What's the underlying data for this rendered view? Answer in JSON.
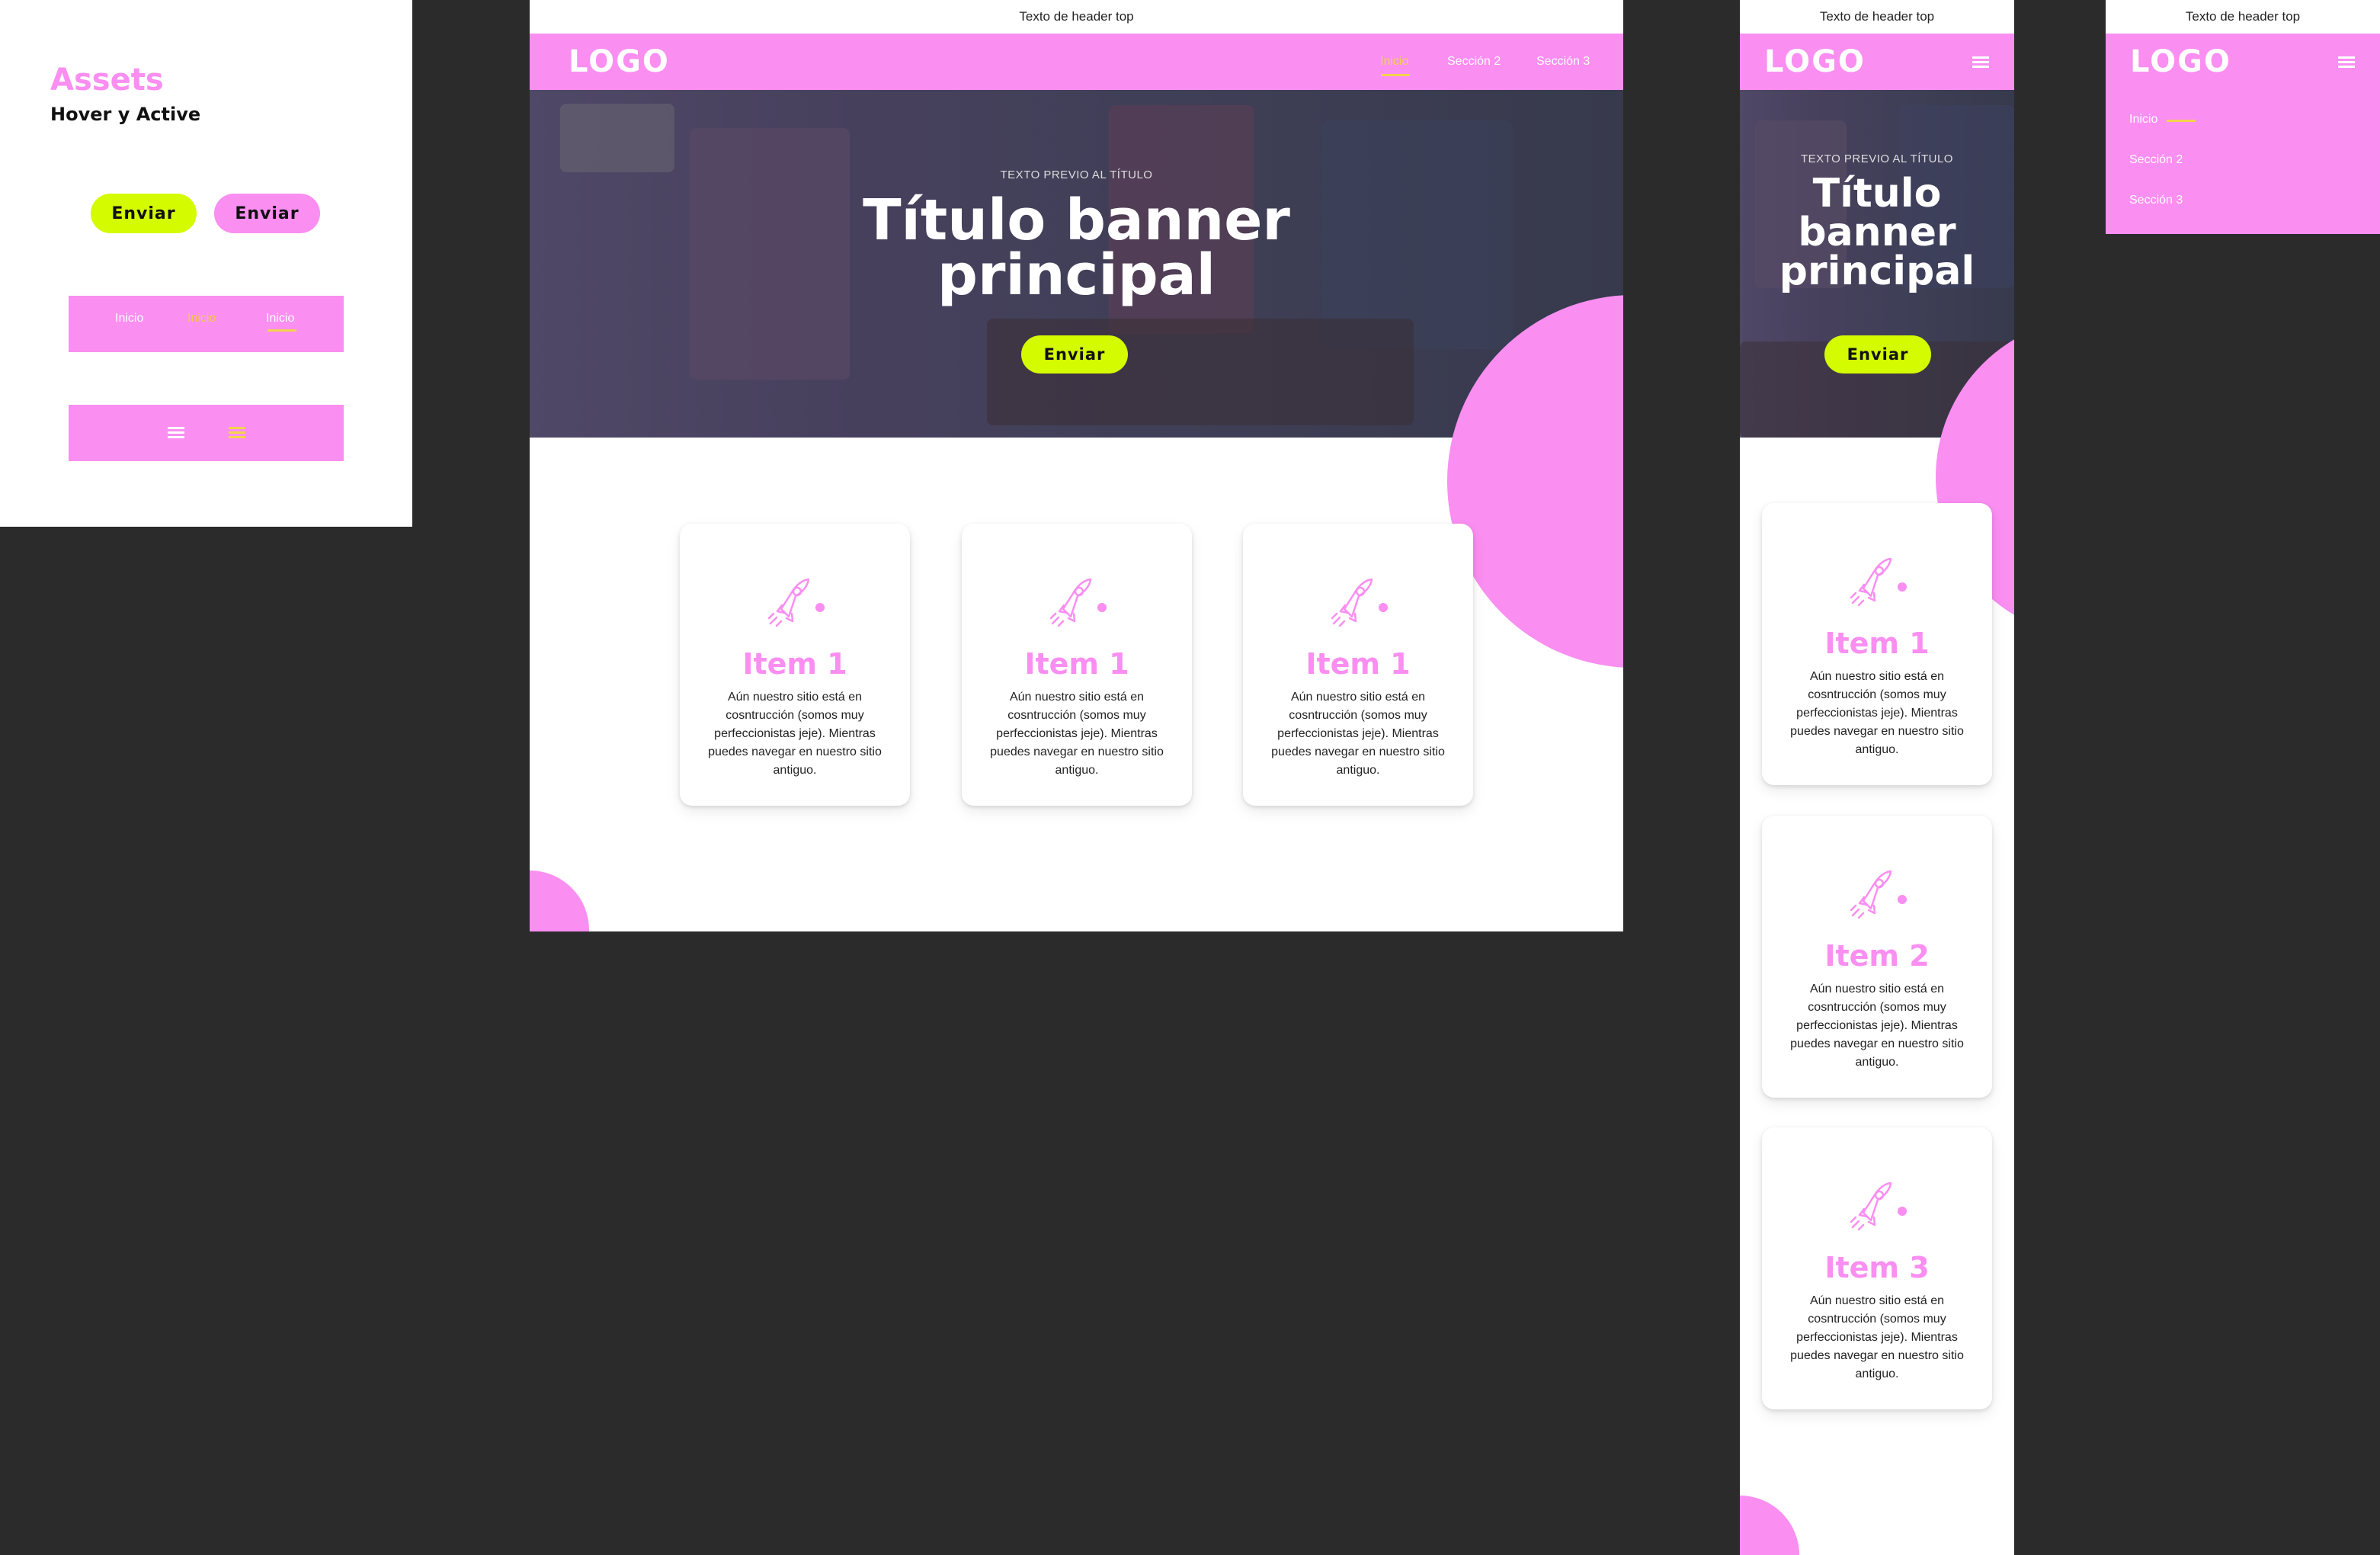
{
  "colors": {
    "pink": "#fa8ef1",
    "lime": "#d4fb00",
    "yellow": "#f2d34c",
    "canvas": "#2b2b2b"
  },
  "assets": {
    "title": "Assets",
    "subtitle": "Hover y Active",
    "btn_lime": "Enviar",
    "btn_pink": "Enviar",
    "nav_items": [
      "Inicio",
      "Inicio",
      "Inicio"
    ]
  },
  "header": {
    "top_text": "Texto de header top",
    "logo": "LOGO",
    "nav": [
      "Inicio",
      "Sección 2",
      "Sección 3"
    ]
  },
  "hero": {
    "kicker": "TEXTO PREVIO AL TÍTULO",
    "title_line1": "Título banner",
    "title_line2": "principal",
    "mobile_title_line1": "Título",
    "mobile_title_line2": "banner",
    "mobile_title_line3": "principal",
    "button": "Enviar"
  },
  "cards_desktop": [
    {
      "title": "Item 1",
      "text": "Aún nuestro sitio está en cosntrucción (somos muy perfeccionistas jeje). Mientras puedes navegar en nuestro sitio antiguo."
    },
    {
      "title": "Item 1",
      "text": "Aún nuestro sitio está en cosntrucción (somos muy perfeccionistas jeje). Mientras puedes navegar en nuestro sitio antiguo."
    },
    {
      "title": "Item 1",
      "text": "Aún nuestro sitio está en cosntrucción (somos muy perfeccionistas jeje). Mientras puedes navegar en nuestro sitio antiguo."
    }
  ],
  "cards_mobile": [
    {
      "title": "Item 1",
      "text": "Aún nuestro sitio está en cosntrucción (somos muy perfeccionistas jeje). Mientras puedes navegar en nuestro sitio antiguo."
    },
    {
      "title": "Item 2",
      "text": "Aún nuestro sitio está en cosntrucción (somos muy perfeccionistas jeje). Mientras puedes navegar en nuestro sitio antiguo."
    },
    {
      "title": "Item 3",
      "text": "Aún nuestro sitio está en cosntrucción (somos muy perfeccionistas jeje). Mientras puedes navegar en nuestro sitio antiguo."
    }
  ],
  "icons": {
    "card": "rocket-icon",
    "menu": "hamburger-menu-icon"
  }
}
